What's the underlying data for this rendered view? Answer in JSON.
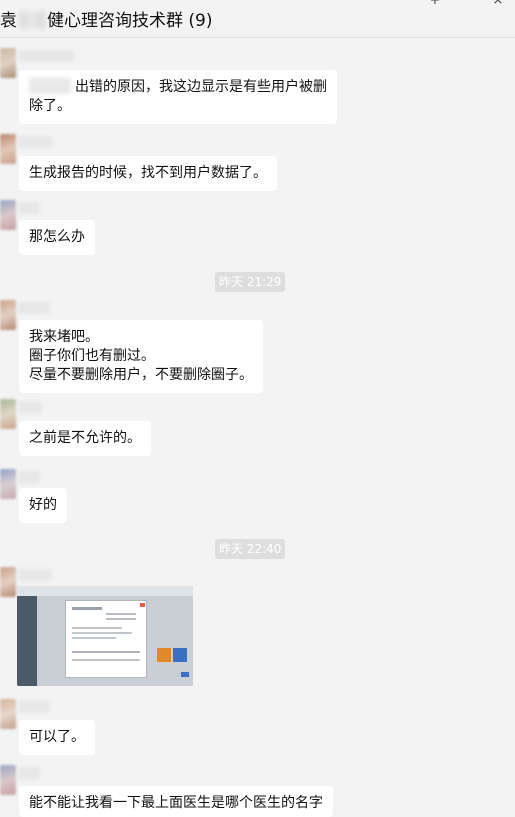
{
  "window": {
    "title_prefix": "袁",
    "title_main": "健心理咨询技术群 (9)",
    "pin_glyph": "+",
    "close_glyph": "×"
  },
  "messages": [
    {
      "text": "出错的原因，我这边显示是有些用户被删\n除了。"
    },
    {
      "text": "生成报告的时候，找不到用户数据了。"
    },
    {
      "text": "那怎么办"
    },
    {
      "text": "我来堵吧。\n圈子你们也有删过。\n尽量不要删除用户，不要删除圈子。"
    },
    {
      "text": "之前是不允许的。"
    },
    {
      "text": "好的"
    },
    {
      "text": "可以了。"
    },
    {
      "text": "能不能让我看一下最上面医生是哪个医生的名字"
    }
  ],
  "timestamps": [
    "昨天 21:29",
    "昨天 22:40"
  ],
  "colors": {
    "background": "#f3f3f3",
    "bubble": "#ffffff",
    "timestamp_badge": "#dedede"
  },
  "icons": {
    "screenshot": "image-attachment-icon"
  }
}
